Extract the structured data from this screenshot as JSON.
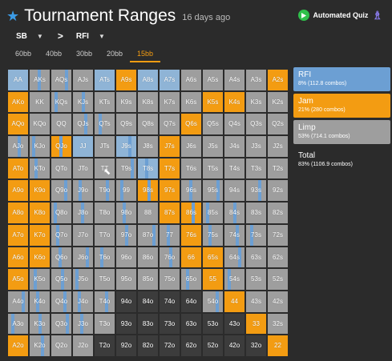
{
  "header": {
    "title": "Tournament Ranges",
    "age": "16 days ago",
    "quiz_label": "Automated Quiz"
  },
  "selectors": {
    "position": "SB",
    "action": "RFI"
  },
  "tabs": [
    {
      "label": "60bb",
      "active": false
    },
    {
      "label": "40bb",
      "active": false
    },
    {
      "label": "30bb",
      "active": false
    },
    {
      "label": "20bb",
      "active": false
    },
    {
      "label": "15bb",
      "active": true
    }
  ],
  "legend": {
    "rfi": {
      "name": "RFI",
      "value": "8% (112.8 combos)"
    },
    "jam": {
      "name": "Jam",
      "value": "21% (280 combos)"
    },
    "limp": {
      "name": "Limp",
      "value": "53% (714.1 combos)"
    },
    "total": {
      "name": "Total",
      "value": "83% (1106.9 combos)"
    }
  },
  "colors": {
    "rfi": "#6c9fd3",
    "jam": "#f39c12",
    "limp": "#9e9e9e",
    "fold": "#3c3c3c"
  },
  "grid": [
    [
      "AA",
      "AKs",
      "AQs",
      "AJs",
      "ATs",
      "A9s",
      "A8s",
      "A7s",
      "A6s",
      "A5s",
      "A4s",
      "A3s",
      "A2s"
    ],
    [
      "AKo",
      "KK",
      "KQs",
      "KJs",
      "KTs",
      "K9s",
      "K8s",
      "K7s",
      "K6s",
      "K5s",
      "K4s",
      "K3s",
      "K2s"
    ],
    [
      "AQo",
      "KQo",
      "QQ",
      "QJs",
      "QTs",
      "Q9s",
      "Q8s",
      "Q7s",
      "Q6s",
      "Q5s",
      "Q4s",
      "Q3s",
      "Q2s"
    ],
    [
      "AJo",
      "KJo",
      "QJo",
      "JJ",
      "JTs",
      "J9s",
      "J8s",
      "J7s",
      "J6s",
      "J5s",
      "J4s",
      "J3s",
      "J2s"
    ],
    [
      "ATo",
      "KTo",
      "QTo",
      "JTo",
      "TT",
      "T9s",
      "T8s",
      "T7s",
      "T6s",
      "T5s",
      "T4s",
      "T3s",
      "T2s"
    ],
    [
      "A9o",
      "K9o",
      "Q9o",
      "J9o",
      "T9o",
      "99",
      "98s",
      "97s",
      "96s",
      "95s",
      "94s",
      "93s",
      "92s"
    ],
    [
      "A8o",
      "K8o",
      "Q8o",
      "J8o",
      "T8o",
      "98o",
      "88",
      "87s",
      "86s",
      "85s",
      "84s",
      "83s",
      "82s"
    ],
    [
      "A7o",
      "K7o",
      "Q7o",
      "J7o",
      "T7o",
      "97o",
      "87o",
      "77",
      "76s",
      "75s",
      "74s",
      "73s",
      "72s"
    ],
    [
      "A6o",
      "K6o",
      "Q6o",
      "J6o",
      "T6o",
      "96o",
      "86o",
      "76o",
      "66",
      "65s",
      "64s",
      "63s",
      "62s"
    ],
    [
      "A5o",
      "K5o",
      "Q5o",
      "J5o",
      "T5o",
      "95o",
      "85o",
      "75o",
      "65o",
      "55",
      "54s",
      "53s",
      "52s"
    ],
    [
      "A4o",
      "K4o",
      "Q4o",
      "J4o",
      "T4o",
      "94o",
      "84o",
      "74o",
      "64o",
      "54o",
      "44",
      "43s",
      "42s"
    ],
    [
      "A3o",
      "K3o",
      "Q3o",
      "J3o",
      "T3o",
      "93o",
      "83o",
      "73o",
      "63o",
      "53o",
      "43o",
      "33",
      "32s"
    ],
    [
      "A2o",
      "K2o",
      "Q2o",
      "J2o",
      "T2o",
      "92o",
      "82o",
      "72o",
      "62o",
      "52o",
      "42o",
      "32o",
      "22"
    ]
  ],
  "cell_status": {
    "orange": [
      "A9s",
      "A2s",
      "AKo",
      "K5s",
      "K4s",
      "AQo",
      "Q6s",
      "QJo",
      "J7s",
      "ATo",
      "T7s",
      "A9o",
      "98s",
      "97s",
      "A8o",
      "87s",
      "86s",
      "A7o",
      "76s",
      "A6o",
      "66",
      "65s",
      "A5o",
      "55",
      "44",
      "33",
      "A2o",
      "22",
      "K7o",
      "K6o",
      "K8o",
      "K9o"
    ],
    "blue": [
      "AA",
      "ATs",
      "A8s",
      "A7s",
      "T8s",
      "J9s",
      "JJ"
    ],
    "dark": [
      "94o",
      "84o",
      "74o",
      "64o",
      "93o",
      "83o",
      "73o",
      "63o",
      "53o",
      "43o",
      "92o",
      "82o",
      "72o",
      "62o",
      "52o",
      "42o",
      "32o",
      "T2o"
    ]
  }
}
